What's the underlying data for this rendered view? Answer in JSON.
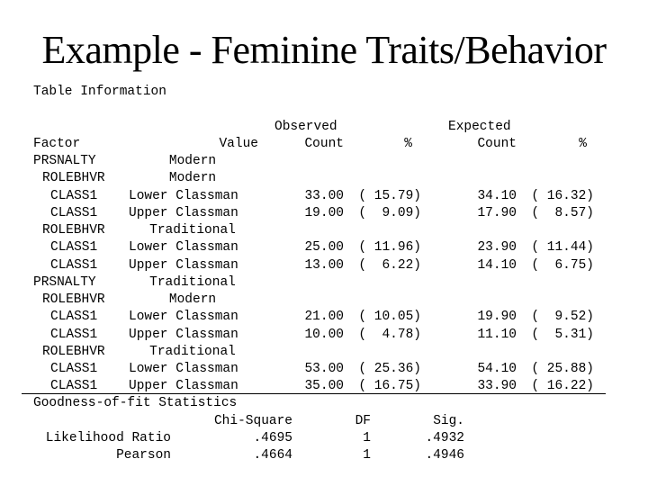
{
  "title": "Example - Feminine Traits/Behavior",
  "subtitle": "Table Information",
  "table": {
    "header_top": {
      "observed": "Observed",
      "expected": "Expected"
    },
    "header": {
      "factor": "Factor",
      "value": "Value",
      "obs_count": "Count",
      "obs_pct": "%",
      "exp_count": "Count",
      "exp_pct": "%"
    },
    "rows": [
      {
        "factor": "PRSNALTY",
        "value": "Modern",
        "level": 0,
        "obs_count": "",
        "obs_pct": "",
        "exp_count": "",
        "exp_pct": ""
      },
      {
        "factor": "ROLEBHVR",
        "value": "Modern",
        "level": 1,
        "obs_count": "",
        "obs_pct": "",
        "exp_count": "",
        "exp_pct": ""
      },
      {
        "factor": "CLASS1",
        "value": "Lower Classman",
        "level": 2,
        "obs_count": "33.00",
        "obs_pct": "( 15.79)",
        "exp_count": "34.10",
        "exp_pct": "( 16.32)"
      },
      {
        "factor": "CLASS1",
        "value": "Upper Classman",
        "level": 2,
        "obs_count": "19.00",
        "obs_pct": "(  9.09)",
        "exp_count": "17.90",
        "exp_pct": "(  8.57)"
      },
      {
        "factor": "ROLEBHVR",
        "value": "Traditional",
        "level": 1,
        "obs_count": "",
        "obs_pct": "",
        "exp_count": "",
        "exp_pct": ""
      },
      {
        "factor": "CLASS1",
        "value": "Lower Classman",
        "level": 2,
        "obs_count": "25.00",
        "obs_pct": "( 11.96)",
        "exp_count": "23.90",
        "exp_pct": "( 11.44)"
      },
      {
        "factor": "CLASS1",
        "value": "Upper Classman",
        "level": 2,
        "obs_count": "13.00",
        "obs_pct": "(  6.22)",
        "exp_count": "14.10",
        "exp_pct": "(  6.75)"
      },
      {
        "factor": "PRSNALTY",
        "value": "Traditional",
        "level": 0,
        "obs_count": "",
        "obs_pct": "",
        "exp_count": "",
        "exp_pct": ""
      },
      {
        "factor": "ROLEBHVR",
        "value": "Modern",
        "level": 1,
        "obs_count": "",
        "obs_pct": "",
        "exp_count": "",
        "exp_pct": ""
      },
      {
        "factor": "CLASS1",
        "value": "Lower Classman",
        "level": 2,
        "obs_count": "21.00",
        "obs_pct": "( 10.05)",
        "exp_count": "19.90",
        "exp_pct": "(  9.52)"
      },
      {
        "factor": "CLASS1",
        "value": "Upper Classman",
        "level": 2,
        "obs_count": "10.00",
        "obs_pct": "(  4.78)",
        "exp_count": "11.10",
        "exp_pct": "(  5.31)"
      },
      {
        "factor": "ROLEBHVR",
        "value": "Traditional",
        "level": 1,
        "obs_count": "",
        "obs_pct": "",
        "exp_count": "",
        "exp_pct": ""
      },
      {
        "factor": "CLASS1",
        "value": "Lower Classman",
        "level": 2,
        "obs_count": "53.00",
        "obs_pct": "( 25.36)",
        "exp_count": "54.10",
        "exp_pct": "( 25.88)"
      },
      {
        "factor": "CLASS1",
        "value": "Upper Classman",
        "level": 2,
        "obs_count": "35.00",
        "obs_pct": "( 16.75)",
        "exp_count": "33.90",
        "exp_pct": "( 16.22)"
      }
    ]
  },
  "gof": {
    "heading": "Goodness-of-fit Statistics",
    "columns": {
      "chi_square": "Chi-Square",
      "df": "DF",
      "sig": "Sig."
    },
    "rows": [
      {
        "label": "Likelihood Ratio",
        "chi_square": ".4695",
        "df": "1",
        "sig": ".4932"
      },
      {
        "label": "Pearson",
        "chi_square": ".4664",
        "df": "1",
        "sig": ".4946"
      }
    ]
  }
}
